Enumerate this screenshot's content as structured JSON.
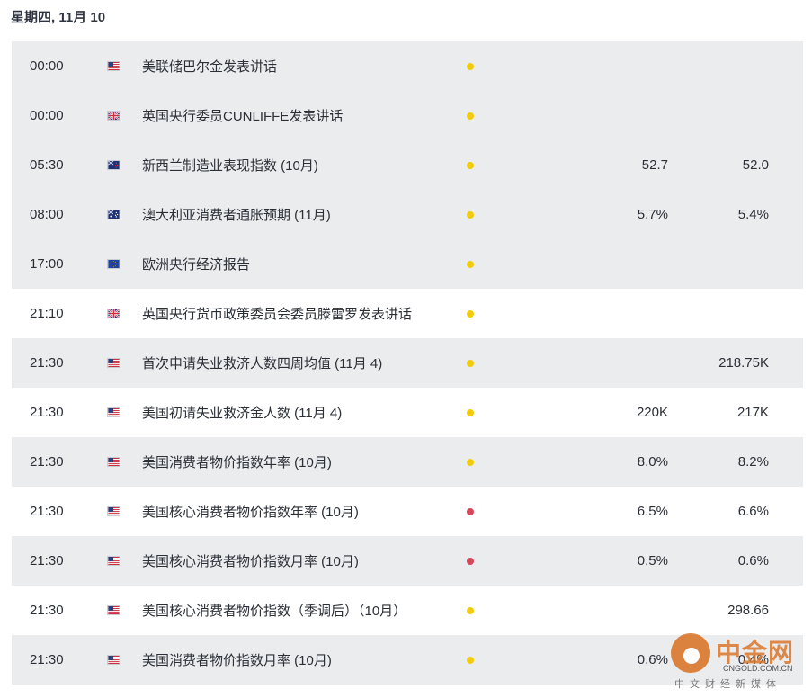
{
  "header": {
    "date": "星期四, 11月 10"
  },
  "colors": {
    "importance_medium": "#f2cc0c",
    "importance_high": "#d3485a",
    "row_shade": "#ebecee"
  },
  "events": [
    {
      "time": "00:00",
      "flag": "us-flag-icon",
      "title": "美联储巴尔金发表讲话",
      "importance": "medium",
      "v1": "",
      "v2": ""
    },
    {
      "time": "00:00",
      "flag": "uk-flag-icon",
      "title": "英国央行委员CUNLIFFE发表讲话",
      "importance": "medium",
      "v1": "",
      "v2": ""
    },
    {
      "time": "05:30",
      "flag": "nz-flag-icon",
      "title": "新西兰制造业表现指数 (10月)",
      "importance": "medium",
      "v1": "52.7",
      "v2": "52.0"
    },
    {
      "time": "08:00",
      "flag": "au-flag-icon",
      "title": "澳大利亚消费者通胀预期 (11月)",
      "importance": "medium",
      "v1": "5.7%",
      "v2": "5.4%"
    },
    {
      "time": "17:00",
      "flag": "eu-flag-icon",
      "title": "欧洲央行经济报告",
      "importance": "medium",
      "v1": "",
      "v2": ""
    },
    {
      "time": "21:10",
      "flag": "uk-flag-icon",
      "title": "英国央行货币政策委员会委员滕雷罗发表讲话",
      "importance": "medium",
      "v1": "",
      "v2": ""
    },
    {
      "time": "21:30",
      "flag": "us-flag-icon",
      "title": "首次申请失业救济人数四周均值 (11月 4)",
      "importance": "medium",
      "v1": "",
      "v2": "218.75K"
    },
    {
      "time": "21:30",
      "flag": "us-flag-icon",
      "title": "美国初请失业救济金人数 (11月 4)",
      "importance": "medium",
      "v1": "220K",
      "v2": "217K"
    },
    {
      "time": "21:30",
      "flag": "us-flag-icon",
      "title": "美国消费者物价指数年率 (10月)",
      "importance": "medium",
      "v1": "8.0%",
      "v2": "8.2%"
    },
    {
      "time": "21:30",
      "flag": "us-flag-icon",
      "title": "美国核心消费者物价指数年率 (10月)",
      "importance": "high",
      "v1": "6.5%",
      "v2": "6.6%"
    },
    {
      "time": "21:30",
      "flag": "us-flag-icon",
      "title": "美国核心消费者物价指数月率 (10月)",
      "importance": "high",
      "v1": "0.5%",
      "v2": "0.6%"
    },
    {
      "time": "21:30",
      "flag": "us-flag-icon",
      "title": "美国核心消费者物价指数（季调后）（10月）",
      "importance": "medium",
      "v1": "",
      "v2": "298.66"
    },
    {
      "time": "21:30",
      "flag": "us-flag-icon",
      "title": "美国消费者物价指数月率 (10月)",
      "importance": "medium",
      "v1": "0.6%",
      "v2": "0.4%"
    }
  ],
  "watermark": {
    "title": "中金网",
    "url": "CNGOLD.COM.CN",
    "subtitle": "中文财经新媒体"
  }
}
